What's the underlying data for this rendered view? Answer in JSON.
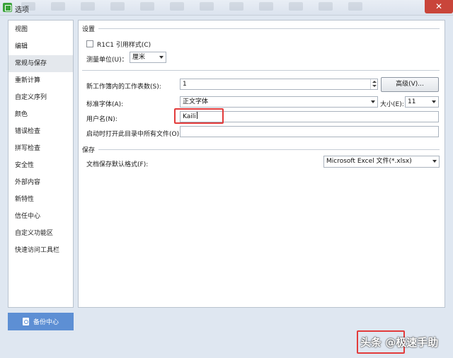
{
  "window": {
    "title": "选项",
    "close_glyph": "✕",
    "icon": "app-icon"
  },
  "sidebar": {
    "items": [
      {
        "label": "视图"
      },
      {
        "label": "编辑"
      },
      {
        "label": "常规与保存",
        "active": true
      },
      {
        "label": "重新计算"
      },
      {
        "label": "自定义序列"
      },
      {
        "label": "颜色"
      },
      {
        "label": "错误检查"
      },
      {
        "label": "拼写检查"
      },
      {
        "label": "安全性"
      },
      {
        "label": "外部内容"
      },
      {
        "label": "新特性"
      },
      {
        "label": "信任中心"
      },
      {
        "label": "自定义功能区"
      },
      {
        "label": "快速访问工具栏"
      }
    ],
    "backup_button": "备份中心"
  },
  "settings": {
    "section_title": "设置",
    "r1c1_label": "R1C1 引用样式(C)",
    "r1c1_checked": false,
    "unit_label": "测量单位(U)：",
    "unit_value": "厘米",
    "sheets_label": "新工作簿内的工作表数(S):",
    "sheets_value": "1",
    "advanced_button": "高级(V)...",
    "font_label": "标准字体(A):",
    "font_value": "正文字体",
    "size_label": "大小(E):",
    "size_value": "11",
    "username_label": "用户名(N):",
    "username_value": "Kaili",
    "startup_label": "启动时打开此目录中所有文件(O):",
    "startup_value": ""
  },
  "save": {
    "section_title": "保存",
    "format_label": "文档保存默认格式(F):",
    "format_value": "Microsoft Excel 文件(*.xlsx)"
  },
  "watermark": {
    "text": "头条 @极速手助"
  },
  "colors": {
    "accent": "#5d8fd4",
    "highlight": "#e23b3b",
    "close": "#c9453a"
  }
}
